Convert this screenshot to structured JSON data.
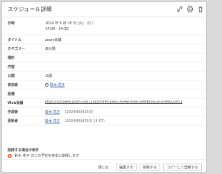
{
  "dialog": {
    "title": "スケジュール詳細"
  },
  "icons": {
    "link": "link-icon",
    "print": "printer-icon",
    "delete": "trash-icon"
  },
  "rows": {
    "datetime": {
      "label": "日時",
      "date": "2024 年 6 月 25 日 (火)",
      "weekday": "赤口",
      "time": "14:00 - 14:30"
    },
    "title": {
      "label": "タイトル",
      "value": "zoom会議"
    },
    "category": {
      "label": "カテゴリー",
      "value": "未分類"
    },
    "place": {
      "label": "場所",
      "value": ""
    },
    "content": {
      "label": "内容",
      "value": ""
    },
    "public": {
      "label": "公開",
      "value": "公開"
    },
    "participants": {
      "label": "参加者",
      "value": "鈴木 花子"
    },
    "facility": {
      "label": "設備",
      "value": ""
    },
    "web": {
      "label": "Web会議",
      "value": "https://us05web.zoom.us/j/1234567890?pwd=XdAwGlebsr3dWdtLnEspYLHiMXZZeO.1"
    },
    "creator": {
      "label": "作成者",
      "name": "鈴木 花子",
      "note": "（2024年6月25日）"
    },
    "updater": {
      "label": "更新者",
      "name": "鈴木 花子",
      "note": "（2024年6月25日 14:57）"
    }
  },
  "delete_condition": {
    "heading": "削除する場合の条件",
    "option": "鈴木 花子 のこの予定を完全に削除します"
  },
  "footer": {
    "close": "閉じる",
    "edit": "編集する",
    "delete": "削除する",
    "copy": "コピーして登録する"
  }
}
